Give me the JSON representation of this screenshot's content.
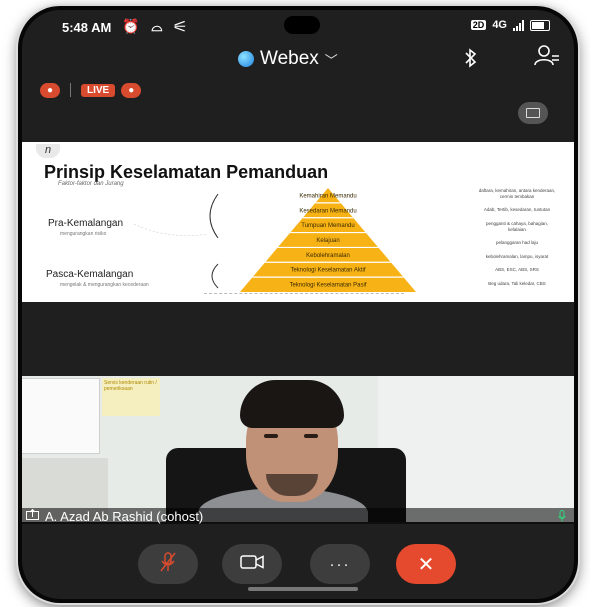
{
  "status_bar": {
    "time": "5:48 AM",
    "left_icons": "⏰ ⌓ ⚟",
    "network": "4G",
    "lte": "2D"
  },
  "header": {
    "app_title": "Webex",
    "chevron": "﹀",
    "bluetooth_icon": "bluetooth-icon",
    "participants_icon": "participants-icon"
  },
  "live_row": {
    "recording_badge": "●",
    "live_label": "LIVE",
    "count_badge": "●"
  },
  "slide": {
    "logo_text": "n",
    "title": "Prinsip Keselamatan Pemanduan",
    "subtitle": "Faktor-faktor dan Jurang",
    "pre_label": "Pra-Kemalangan",
    "pre_sub": "mengurangkan risiko",
    "post_label": "Pasca-Kemalangan",
    "post_sub": "mengelak & mengurangkan kecederaan",
    "pyramid_levels": [
      "Kemahiran Memandu",
      "Kesedaran Memandu",
      "Tumpuan Memandu",
      "Kelajuan",
      "Kebolehramalan",
      "Teknologi Keselamatan Aktif",
      "Teknologi Keselamatan Pasif"
    ],
    "notes": [
      "daftara, kemahiran, antara kenderaan, cermin tembakan",
      "Adab, Tertib, kesedaran, tuntutan",
      "pengganti & cahaya, bahagian, kelalaian",
      "pelanggaran had laju",
      "kebolehramalan, lampu, isyarat",
      "ABS, ESC, ABS, SRS",
      "Beg udara, Tali keledar, CBS"
    ],
    "accent_color": "#f7b216"
  },
  "video": {
    "sticky_text": "Servis kenderaan rutin / pemeriksaan",
    "participant_name": "A. Azad Ab Rashid (cohost)"
  },
  "controls": {
    "mute_icon": "mic-off-icon",
    "video_icon": "video-icon",
    "more_label": "···",
    "leave_icon": "close-icon",
    "leave_label": "✕"
  }
}
